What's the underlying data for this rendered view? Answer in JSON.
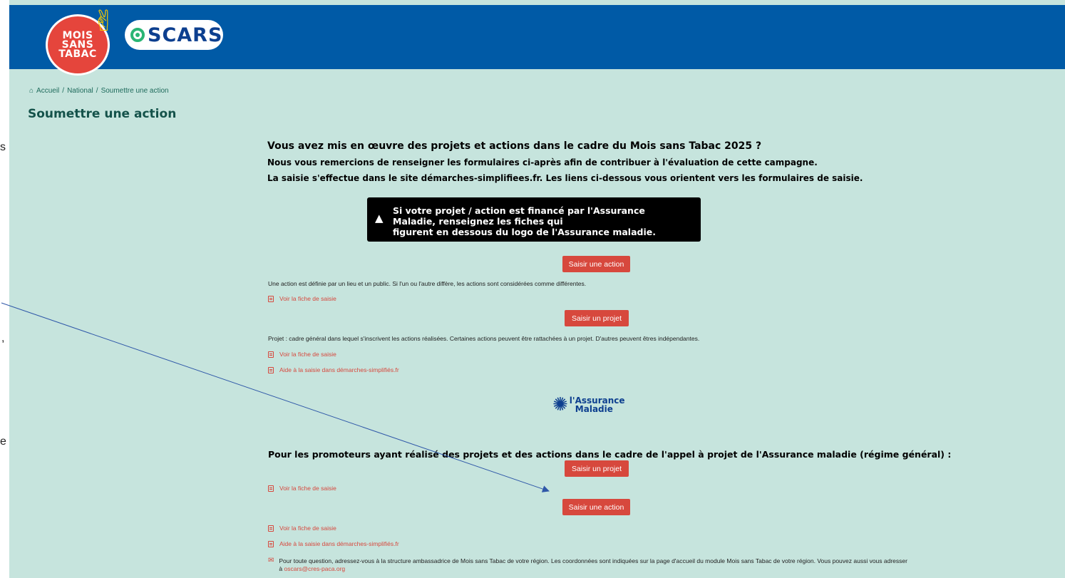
{
  "edge_glyphs": [
    "s",
    ",",
    "e"
  ],
  "logo": {
    "mois_line1": "MOIS",
    "mois_line2": "SANS",
    "mois_line3": "TABAC",
    "oscars_word": "SCARS",
    "colors": {
      "circle": "#e5453c",
      "ring": "#2ab574",
      "word": "#0d3f8f",
      "hand": "#f6c700"
    }
  },
  "breadcrumb": {
    "home": "Accueil",
    "sep1": "/",
    "national": "National",
    "sep2": "/",
    "current": "Soumettre une action"
  },
  "page_title": "Soumettre une action",
  "intro": {
    "question": "Vous avez mis en œuvre des projets et actions dans le cadre du Mois sans Tabac 2025 ?",
    "line1": "Nous vous remercions de renseigner les formulaires ci-après afin de contribuer à l'évaluation de cette campagne.",
    "line2": "La saisie s'effectue dans le site démarches-simplifiees.fr. Les liens ci-dessous vous orientent vers les formulaires de saisie."
  },
  "warning": {
    "line1": "Si votre projet / action est financé par l'Assurance Maladie, renseignez les fiches qui",
    "line2": "figurent en dessous du logo de l'Assurance maladie."
  },
  "section1": {
    "action_button": "Saisir une action",
    "action_note": "Une action est définie par un lieu et un public. Si l'un ou l'autre diffère, les actions sont considérées comme différentes.",
    "action_link": "Voir la fiche de saisie",
    "project_button": "Saisir un projet",
    "project_note": "Projet : cadre général dans lequel s'inscrivent les actions réalisées. Certaines actions peuvent être rattachées à un projet. D'autres peuvent êtres indépendantes.",
    "project_link": "Voir la fiche de saisie",
    "help_link": "Aide à la saisie dans démarches-simplifiés.fr"
  },
  "assurance_logo": {
    "line1": "l'Assurance",
    "line2": "Maladie"
  },
  "section2": {
    "heading": "Pour les promoteurs ayant réalisé des projets et des actions dans le cadre de l'appel à projet de l'Assurance maladie (régime général) :",
    "project_button": "Saisir un projet",
    "project_link": "Voir la fiche de saisie",
    "action_button": "Saisir une action",
    "action_link": "Voir la fiche de saisie",
    "help_link": "Aide à la saisie dans démarches-simplifiés.fr",
    "contact_text": "Pour toute question, adressez-vous à la structure ambassadrice de Mois sans Tabac de votre région. Les coordonnées sont indiquées sur la page d'accueil du module Mois sans Tabac de votre région. Vous pouvez aussi vous adresser à",
    "contact_email": "oscars@cres-paca.org"
  },
  "colors": {
    "header": "#005aa6",
    "background": "#c6e4dd",
    "button": "#d7483d",
    "title": "#14524a",
    "annotation_arrow": "#2f57a8"
  }
}
